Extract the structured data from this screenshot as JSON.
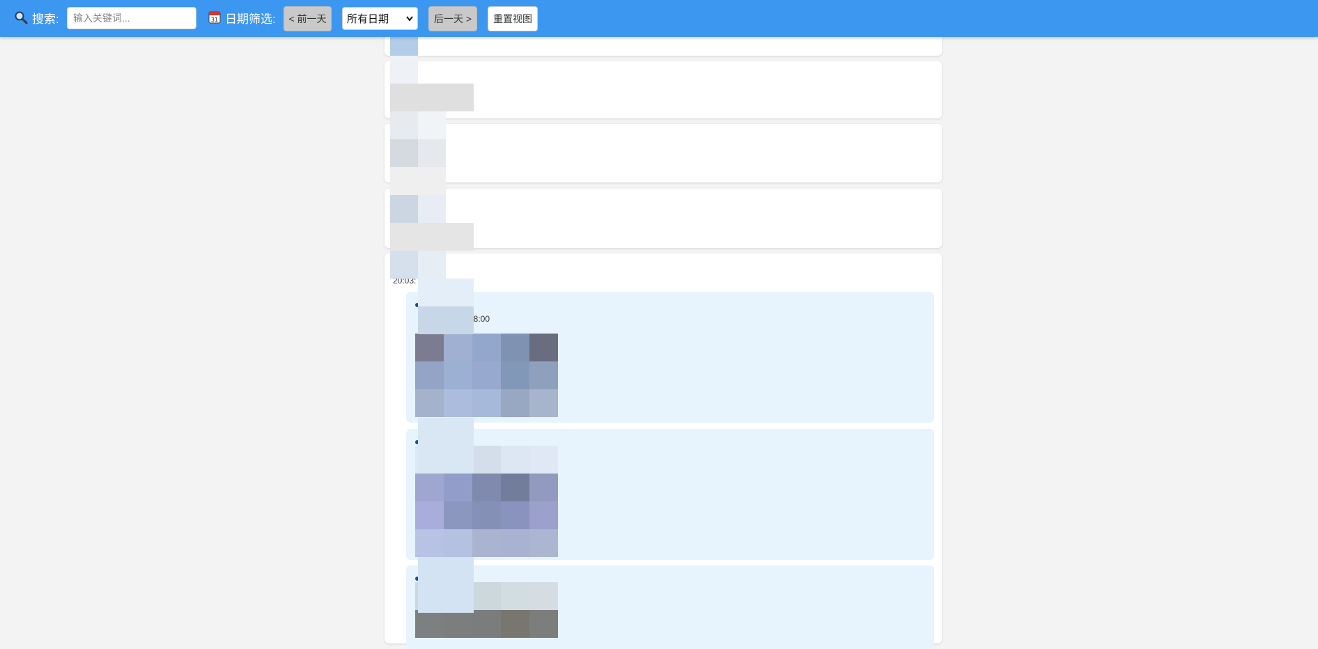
{
  "toolbar": {
    "search_icon": "magnifier-icon",
    "search_label": "搜索:",
    "search_placeholder": "输入关键词...",
    "calendar_icon": "calendar-icon",
    "calendar_number": "31",
    "date_filter_label": "日期筛选:",
    "prev_day_label": "< 前一天",
    "date_select_value": "所有日期",
    "next_day_label": "后一天 >",
    "reset_label": "重置视图",
    "accent_color": "#3c97f0"
  },
  "feed": {
    "time_visible": "20:03:",
    "sub_items": [
      {
        "time_visible": "08:00"
      },
      {
        "time_visible": ""
      },
      {
        "time_visible": ""
      }
    ]
  }
}
